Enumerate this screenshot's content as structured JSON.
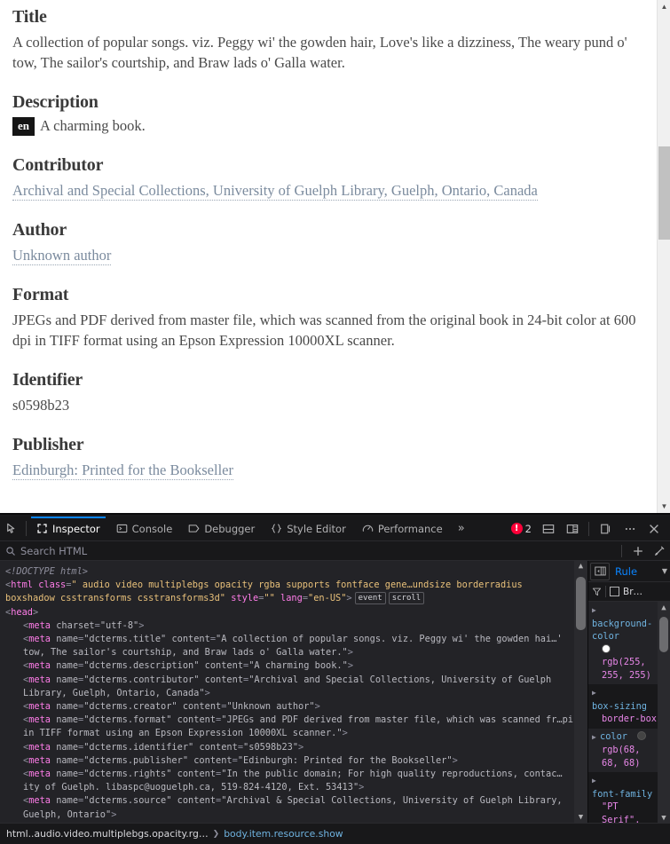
{
  "page": {
    "fields": [
      {
        "label": "Title",
        "value": "A collection of popular songs. viz. Peggy wi' the gowden hair, Love's like a dizziness, The weary pund o' tow, The sailor's courtship, and Braw lads o' Galla water.",
        "link": false
      },
      {
        "label": "Description",
        "lang": "en",
        "value": "A charming book.",
        "link": false
      },
      {
        "label": "Contributor",
        "value": "Archival and Special Collections, University of Guelph Library, Guelph, Ontario, Canada",
        "link": true
      },
      {
        "label": "Author",
        "value": "Unknown author",
        "link": true
      },
      {
        "label": "Format",
        "value": "JPEGs and PDF derived from master file, which was scanned from the original book in 24-bit color at 600 dpi in TIFF format using an Epson Expression 10000XL scanner.",
        "link": false
      },
      {
        "label": "Identifier",
        "value": "s0598b23",
        "link": false
      },
      {
        "label": "Publisher",
        "value": "Edinburgh: Printed for the Bookseller",
        "link": true
      }
    ]
  },
  "devtools": {
    "tabs": [
      {
        "label": "Inspector",
        "icon": "inspector-icon",
        "active": true
      },
      {
        "label": "Console",
        "icon": "console-icon",
        "active": false
      },
      {
        "label": "Debugger",
        "icon": "debugger-icon",
        "active": false
      },
      {
        "label": "Style Editor",
        "icon": "style-editor-icon",
        "active": false
      },
      {
        "label": "Performance",
        "icon": "performance-icon",
        "active": false
      }
    ],
    "overflow_label": "»",
    "error_count": "2",
    "search": {
      "placeholder": "Search HTML"
    },
    "markup": [
      {
        "indent": 0,
        "twisty": "",
        "parts": [
          {
            "t": "doctype",
            "s": "<!DOCTYPE html>"
          }
        ]
      },
      {
        "indent": 0,
        "twisty": "",
        "parts": [
          {
            "t": "punct",
            "s": "<"
          },
          {
            "t": "tag",
            "s": "html"
          },
          {
            "t": "sp",
            "s": " "
          },
          {
            "t": "attr",
            "s": "class"
          },
          {
            "t": "punct",
            "s": "="
          },
          {
            "t": "val",
            "s": "\" audio video multiplebgs opacity rgba supports fontface gene…undsize borderradius boxshadow csstransforms csstransforms3d\""
          },
          {
            "t": "sp",
            "s": " "
          },
          {
            "t": "attr",
            "s": "style"
          },
          {
            "t": "punct",
            "s": "="
          },
          {
            "t": "val",
            "s": "\"\""
          },
          {
            "t": "sp",
            "s": " "
          },
          {
            "t": "attr",
            "s": "lang"
          },
          {
            "t": "punct",
            "s": "="
          },
          {
            "t": "val",
            "s": "\"en-US\""
          },
          {
            "t": "punct",
            "s": ">"
          },
          {
            "t": "badge",
            "s": "event"
          },
          {
            "t": "badge",
            "s": "scroll"
          }
        ]
      },
      {
        "indent": 0,
        "twisty": "▼",
        "parts": [
          {
            "t": "punct",
            "s": "<"
          },
          {
            "t": "tag",
            "s": "head"
          },
          {
            "t": "punct",
            "s": ">"
          }
        ]
      },
      {
        "indent": 1,
        "twisty": "",
        "parts": [
          {
            "t": "punct",
            "s": "<"
          },
          {
            "t": "tag",
            "s": "meta"
          },
          {
            "t": "sp",
            "s": " "
          },
          {
            "t": "attrname-d",
            "s": "charset"
          },
          {
            "t": "punct",
            "s": "="
          },
          {
            "t": "val2",
            "s": "\"utf-8\""
          },
          {
            "t": "punct",
            "s": ">"
          }
        ]
      },
      {
        "indent": 1,
        "twisty": "",
        "parts": [
          {
            "t": "punct",
            "s": "<"
          },
          {
            "t": "tag",
            "s": "meta"
          },
          {
            "t": "sp",
            "s": " "
          },
          {
            "t": "attrname-d",
            "s": "name"
          },
          {
            "t": "punct",
            "s": "="
          },
          {
            "t": "val2",
            "s": "\"dcterms.title\""
          },
          {
            "t": "sp",
            "s": " "
          },
          {
            "t": "attrname-d",
            "s": "content"
          },
          {
            "t": "punct",
            "s": "="
          },
          {
            "t": "val2",
            "s": "\"A collection of popular songs. viz. Peggy wi' the gowden hai…' tow, The sailor's courtship, and Braw lads o' Galla water.\""
          },
          {
            "t": "punct",
            "s": ">"
          }
        ]
      },
      {
        "indent": 1,
        "twisty": "",
        "parts": [
          {
            "t": "punct",
            "s": "<"
          },
          {
            "t": "tag",
            "s": "meta"
          },
          {
            "t": "sp",
            "s": " "
          },
          {
            "t": "attrname-d",
            "s": "name"
          },
          {
            "t": "punct",
            "s": "="
          },
          {
            "t": "val2",
            "s": "\"dcterms.description\""
          },
          {
            "t": "sp",
            "s": " "
          },
          {
            "t": "attrname-d",
            "s": "content"
          },
          {
            "t": "punct",
            "s": "="
          },
          {
            "t": "val2",
            "s": "\"A charming book.\""
          },
          {
            "t": "punct",
            "s": ">"
          }
        ]
      },
      {
        "indent": 1,
        "twisty": "",
        "parts": [
          {
            "t": "punct",
            "s": "<"
          },
          {
            "t": "tag",
            "s": "meta"
          },
          {
            "t": "sp",
            "s": " "
          },
          {
            "t": "attrname-d",
            "s": "name"
          },
          {
            "t": "punct",
            "s": "="
          },
          {
            "t": "val2",
            "s": "\"dcterms.contributor\""
          },
          {
            "t": "sp",
            "s": " "
          },
          {
            "t": "attrname-d",
            "s": "content"
          },
          {
            "t": "punct",
            "s": "="
          },
          {
            "t": "val2",
            "s": "\"Archival and Special Collections, University of Guelph Library, Guelph, Ontario, Canada\""
          },
          {
            "t": "punct",
            "s": ">"
          }
        ]
      },
      {
        "indent": 1,
        "twisty": "",
        "parts": [
          {
            "t": "punct",
            "s": "<"
          },
          {
            "t": "tag",
            "s": "meta"
          },
          {
            "t": "sp",
            "s": " "
          },
          {
            "t": "attrname-d",
            "s": "name"
          },
          {
            "t": "punct",
            "s": "="
          },
          {
            "t": "val2",
            "s": "\"dcterms.creator\""
          },
          {
            "t": "sp",
            "s": " "
          },
          {
            "t": "attrname-d",
            "s": "content"
          },
          {
            "t": "punct",
            "s": "="
          },
          {
            "t": "val2",
            "s": "\"Unknown author\""
          },
          {
            "t": "punct",
            "s": ">"
          }
        ]
      },
      {
        "indent": 1,
        "twisty": "",
        "parts": [
          {
            "t": "punct",
            "s": "<"
          },
          {
            "t": "tag",
            "s": "meta"
          },
          {
            "t": "sp",
            "s": " "
          },
          {
            "t": "attrname-d",
            "s": "name"
          },
          {
            "t": "punct",
            "s": "="
          },
          {
            "t": "val2",
            "s": "\"dcterms.format\""
          },
          {
            "t": "sp",
            "s": " "
          },
          {
            "t": "attrname-d",
            "s": "content"
          },
          {
            "t": "punct",
            "s": "="
          },
          {
            "t": "val2",
            "s": "\"JPEGs and PDF derived from master file, which was scanned fr…pi in TIFF format using an Epson Expression 10000XL scanner.\""
          },
          {
            "t": "punct",
            "s": ">"
          }
        ]
      },
      {
        "indent": 1,
        "twisty": "",
        "parts": [
          {
            "t": "punct",
            "s": "<"
          },
          {
            "t": "tag",
            "s": "meta"
          },
          {
            "t": "sp",
            "s": " "
          },
          {
            "t": "attrname-d",
            "s": "name"
          },
          {
            "t": "punct",
            "s": "="
          },
          {
            "t": "val2",
            "s": "\"dcterms.identifier\""
          },
          {
            "t": "sp",
            "s": " "
          },
          {
            "t": "attrname-d",
            "s": "content"
          },
          {
            "t": "punct",
            "s": "="
          },
          {
            "t": "val2",
            "s": "\"s0598b23\""
          },
          {
            "t": "punct",
            "s": ">"
          }
        ]
      },
      {
        "indent": 1,
        "twisty": "",
        "parts": [
          {
            "t": "punct",
            "s": "<"
          },
          {
            "t": "tag",
            "s": "meta"
          },
          {
            "t": "sp",
            "s": " "
          },
          {
            "t": "attrname-d",
            "s": "name"
          },
          {
            "t": "punct",
            "s": "="
          },
          {
            "t": "val2",
            "s": "\"dcterms.publisher\""
          },
          {
            "t": "sp",
            "s": " "
          },
          {
            "t": "attrname-d",
            "s": "content"
          },
          {
            "t": "punct",
            "s": "="
          },
          {
            "t": "val2",
            "s": "\"Edinburgh: Printed for the Bookseller\""
          },
          {
            "t": "punct",
            "s": ">"
          }
        ]
      },
      {
        "indent": 1,
        "twisty": "",
        "parts": [
          {
            "t": "punct",
            "s": "<"
          },
          {
            "t": "tag",
            "s": "meta"
          },
          {
            "t": "sp",
            "s": " "
          },
          {
            "t": "attrname-d",
            "s": "name"
          },
          {
            "t": "punct",
            "s": "="
          },
          {
            "t": "val2",
            "s": "\"dcterms.rights\""
          },
          {
            "t": "sp",
            "s": " "
          },
          {
            "t": "attrname-d",
            "s": "content"
          },
          {
            "t": "punct",
            "s": "="
          },
          {
            "t": "val2",
            "s": "\"In the public domain; For high quality reproductions, contac…ity of Guelph. libaspc@uoguelph.ca, 519-824-4120, Ext. 53413\""
          },
          {
            "t": "punct",
            "s": ">"
          }
        ]
      },
      {
        "indent": 1,
        "twisty": "",
        "parts": [
          {
            "t": "punct",
            "s": "<"
          },
          {
            "t": "tag",
            "s": "meta"
          },
          {
            "t": "sp",
            "s": " "
          },
          {
            "t": "attrname-d",
            "s": "name"
          },
          {
            "t": "punct",
            "s": "="
          },
          {
            "t": "val2",
            "s": "\"dcterms.source\""
          },
          {
            "t": "sp",
            "s": " "
          },
          {
            "t": "attrname-d",
            "s": "content"
          },
          {
            "t": "punct",
            "s": "="
          },
          {
            "t": "val2",
            "s": "\"Archival & Special Collections, University of Guelph Library, Guelph, Ontario\""
          },
          {
            "t": "punct",
            "s": ">"
          }
        ]
      }
    ],
    "rules": {
      "tab_label": "Rule",
      "filter_label": "Br…",
      "declarations": [
        {
          "property": "background-color",
          "value": "rgb(255, 255, 255)",
          "swatch": "#ffffff",
          "expandable": true
        },
        {
          "property": "box-sizing",
          "value": "border-box",
          "swatch": null,
          "expandable": true
        },
        {
          "property": "color",
          "value": "rgb(68, 68, 68)",
          "swatch": "#444444",
          "expandable": true
        },
        {
          "property": "font-family",
          "value": "\"PT Serif\",",
          "swatch": null,
          "expandable": true
        }
      ]
    },
    "breadcrumb": [
      {
        "label": "html..audio.video.multiplebgs.opacity.rg…",
        "selected": false
      },
      {
        "label": "body.item.resource.show",
        "selected": true
      }
    ]
  }
}
